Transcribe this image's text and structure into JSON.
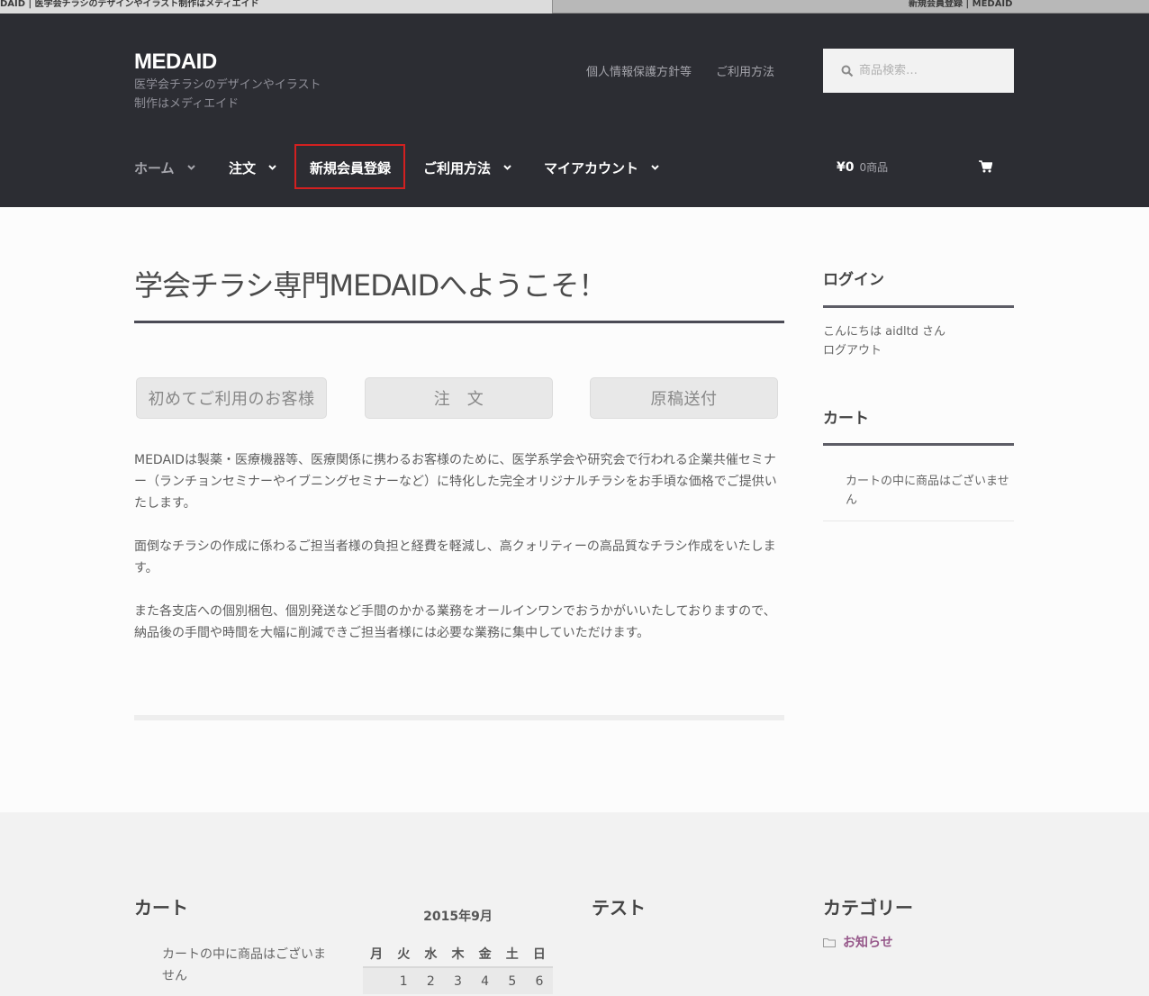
{
  "browser": {
    "active_tab": "DAID | 医学会チラシのデザインやイラスト制作はメディエイド",
    "other_tab": "新規会員登録 | MEDAID"
  },
  "header": {
    "site_title": "MEDAID",
    "site_description": "医学会チラシのデザインやイラスト制作はメディエイド",
    "secondary_nav": [
      "個人情報保護方針等",
      "ご利用方法"
    ],
    "search_placeholder": "商品検索…",
    "main_nav": [
      {
        "label": "ホーム",
        "has_dropdown": true
      },
      {
        "label": "注文",
        "has_dropdown": true
      },
      {
        "label": "新規会員登録",
        "has_dropdown": false,
        "highlighted": true
      },
      {
        "label": "ご利用方法",
        "has_dropdown": true
      },
      {
        "label": "マイアカウント",
        "has_dropdown": true
      }
    ],
    "cart_total": "¥0",
    "cart_count": "0商品",
    "cart_icon": "shopping-cart-icon"
  },
  "content": {
    "page_title": "学会チラシ専門MEDAIDへようこそ！",
    "buttons": [
      "初めてご利用のお客様",
      "注　文",
      "原稿送付"
    ],
    "paragraphs": [
      "MEDAIDは製薬・医療機器等、医療関係に携わるお客様のために、医学系学会や研究会で行われる企業共催セミナー（ランチョンセミナーやイブニングセミナーなど）に特化した完全オリジナルチラシをお手頃な価格でご提供いたします。",
      "面倒なチラシの作成に係わるご担当者様の負担と経費を軽減し、高クォリティーの高品質なチラシ作成をいたします。",
      "また各支店への個別梱包、個別発送など手間のかかる業務をオールインワンでおうかがいいたしておりますので、納品後の手間や時間を大幅に削減できご担当者様には必要な業務に集中していただけます。"
    ]
  },
  "sidebar": {
    "login_title": "ログイン",
    "greeting": "こんにちは aidltd さん",
    "logout": "ログアウト",
    "cart_title": "カート",
    "cart_empty": "カートの中に商品はございません"
  },
  "footer": {
    "cart_title": "カート",
    "cart_empty": "カートの中に商品はございません",
    "calendar_caption": "2015年9月",
    "calendar_headers": [
      "月",
      "火",
      "水",
      "木",
      "金",
      "土",
      "日"
    ],
    "calendar_first_row": [
      "",
      "1",
      "2",
      "3",
      "4",
      "5",
      "6"
    ],
    "test_title": "テスト",
    "category_title": "カテゴリー",
    "category_link": "お知らせ"
  },
  "colors": {
    "header_bg": "#2c2d33",
    "highlight_border": "#d32020",
    "category_link": "#96588a"
  }
}
